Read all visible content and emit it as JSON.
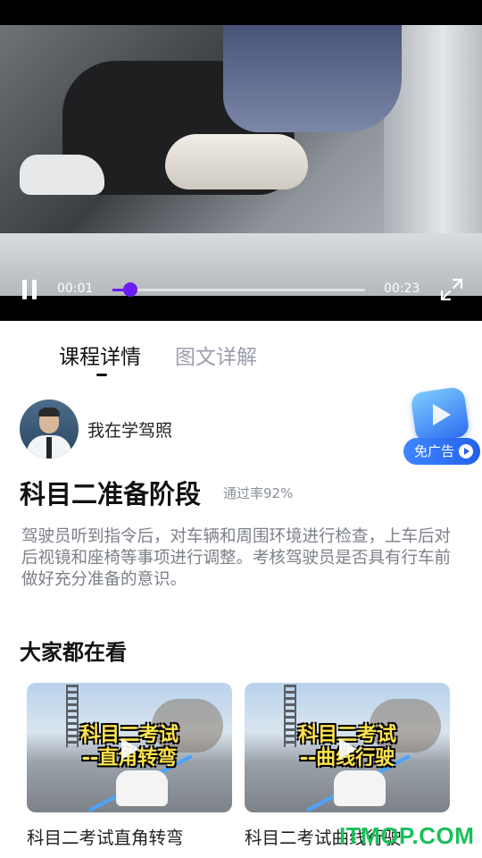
{
  "player": {
    "current_time": "00:01",
    "total_time": "00:23",
    "progress": 0.07,
    "accent_color": "#6a1df2"
  },
  "tabs": [
    {
      "label": "课程详情",
      "active": true
    },
    {
      "label": "图文详解",
      "active": false
    }
  ],
  "author": {
    "name": "我在学驾照"
  },
  "ad_badge": {
    "label": "免广告"
  },
  "lesson": {
    "title": "科目二准备阶段",
    "pass_rate": "通过率92%",
    "description": "驾驶员听到指令后，对车辆和周围环境进行检查，上车后对后视镜和座椅等事项进行调整。考核驾驶员是否具有行车前做好充分准备的意识。"
  },
  "section": {
    "title": "大家都在看"
  },
  "videos": [
    {
      "overlay_line1": "科目二考试",
      "overlay_line2": "--直角转弯",
      "title": "科目二考试直角转弯"
    },
    {
      "overlay_line1": "科目二考试",
      "overlay_line2": "--曲线行驶",
      "title": "科目二考试曲线行驶"
    }
  ],
  "watermark": "ITMOP.COM",
  "icons": {
    "pause": "pause-icon",
    "fullscreen": "fullscreen-icon",
    "play": "play-icon"
  }
}
